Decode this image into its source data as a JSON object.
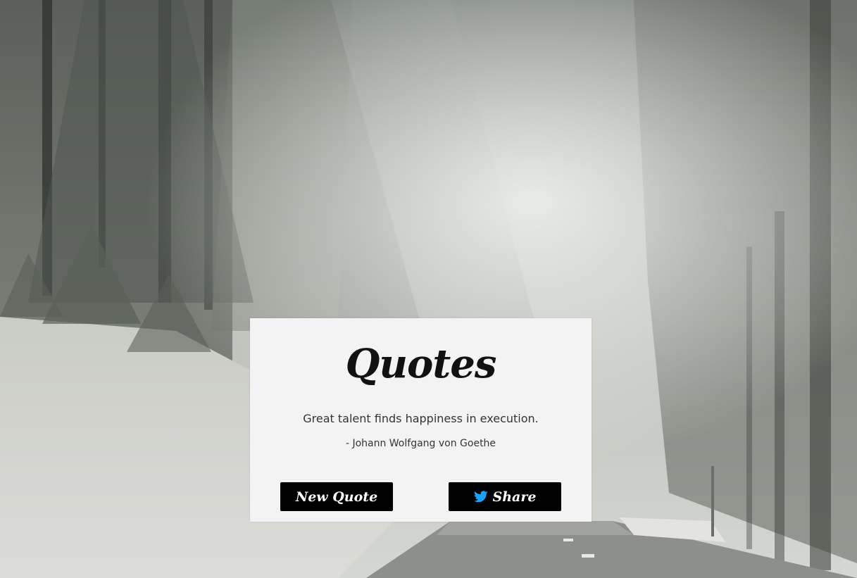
{
  "card": {
    "title": "Quotes",
    "quote": "Great talent finds happiness in execution.",
    "author": "- Johann Wolfgang von Goethe"
  },
  "buttons": {
    "new_quote_label": "New Quote",
    "share_label": "Share",
    "share_icon": "twitter-bird-icon"
  },
  "colors": {
    "card_background": "#f3f3f3",
    "button_background": "#000000",
    "button_text": "#ffffff",
    "twitter_blue": "#1da1f2"
  },
  "background": {
    "description_icon": "snowy-forest-road-photo"
  }
}
